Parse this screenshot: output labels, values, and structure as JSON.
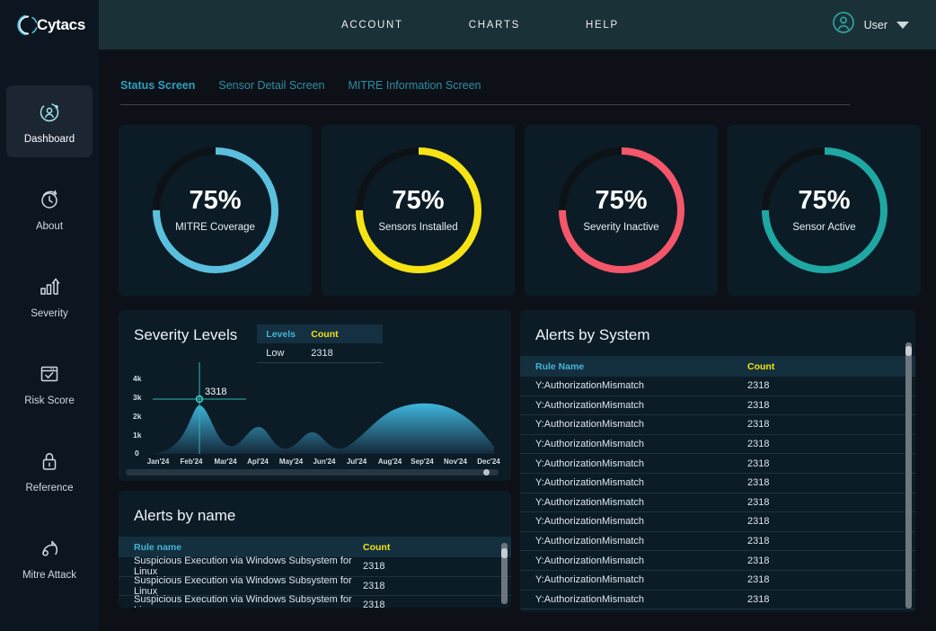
{
  "brand": {
    "name": "Cytacs",
    "logo_icon": "cytacs-arcs-logo"
  },
  "sidebar": {
    "items": [
      {
        "label": "Dashboard",
        "icon": "user-refresh-icon",
        "active": true
      },
      {
        "label": "About",
        "icon": "clock-refresh-icon",
        "active": false
      },
      {
        "label": "Severity",
        "icon": "bar-chart-up-icon",
        "active": false
      },
      {
        "label": "Risk Score",
        "icon": "checklist-window-icon",
        "active": false
      },
      {
        "label": "Reference",
        "icon": "lock-icon",
        "active": false
      },
      {
        "label": "Mitre Attack",
        "icon": "gauge-meter-icon",
        "active": false
      }
    ]
  },
  "header": {
    "nav": [
      {
        "label": "ACCOUNT"
      },
      {
        "label": "CHARTS"
      },
      {
        "label": "HELP"
      }
    ],
    "user": {
      "name": "User",
      "avatar_icon": "user-circle-icon",
      "caret_icon": "caret-down-icon"
    }
  },
  "tabs": [
    {
      "label": "Status Screen",
      "active": true
    },
    {
      "label": "Sensor Detail Screen",
      "active": false
    },
    {
      "label": "MITRE Information Screen",
      "active": false
    }
  ],
  "gauges": [
    {
      "percent": "75%",
      "value": 75,
      "label": "MITRE Coverage",
      "color": "#5bc0de",
      "track": "#0d1216"
    },
    {
      "percent": "75%",
      "value": 75,
      "label": "Sensors Installed",
      "color": "#f5e315",
      "track": "#0d1216"
    },
    {
      "percent": "75%",
      "value": 75,
      "label": "Severity Inactive",
      "color": "#f4566a",
      "track": "#0d1216"
    },
    {
      "percent": "75%",
      "value": 75,
      "label": "Sensor Active",
      "color": "#1fa7a3",
      "track": "#0d1216"
    }
  ],
  "severity_panel": {
    "title": "Severity Levels",
    "legend": {
      "columns": [
        "Levels",
        "Count"
      ],
      "rows": [
        {
          "level": "Low",
          "count": "2318"
        }
      ]
    }
  },
  "chart_data": {
    "type": "area",
    "title": "Severity Levels",
    "xlabel": "",
    "ylabel": "",
    "ylim": [
      0,
      4000
    ],
    "ytick_labels": [
      "0",
      "1k",
      "2k",
      "3k",
      "4k"
    ],
    "ytick_values": [
      0,
      1000,
      2000,
      3000,
      4000
    ],
    "categories": [
      "Jan'24",
      "Feb'24",
      "Mar'24",
      "Apl'24",
      "May'24",
      "Jun'24",
      "Jul'24",
      "Aug'24",
      "Sep'24",
      "Nov'24",
      "Dec'24"
    ],
    "series": [
      {
        "name": "Low",
        "values": [
          60,
          2450,
          700,
          1300,
          620,
          900,
          640,
          1750,
          2380,
          2180,
          380
        ]
      }
    ],
    "annotation": {
      "label": "3318",
      "x_category": "Feb'24",
      "y_value": 3318,
      "crosshair": true
    },
    "grid": false,
    "legend_position": "top-right",
    "has_horizontal_scrollbar": true
  },
  "alerts_by_name": {
    "title": "Alerts by name",
    "columns": [
      "Rule name",
      "Count"
    ],
    "rows": [
      {
        "rule": "Suspicious Execution via Windows Subsystem for Linux",
        "count": "2318"
      },
      {
        "rule": "Suspicious Execution via Windows Subsystem for Linux",
        "count": "2318"
      },
      {
        "rule": "Suspicious Execution via Windows Subsystem for Linux",
        "count": "2318"
      }
    ]
  },
  "alerts_by_system": {
    "title": "Alerts by System",
    "columns": [
      "Rule Name",
      "Count"
    ],
    "rows": [
      {
        "rule": "Y:AuthorizationMismatch",
        "count": "2318"
      },
      {
        "rule": "Y:AuthorizationMismatch",
        "count": "2318"
      },
      {
        "rule": "Y:AuthorizationMismatch",
        "count": "2318"
      },
      {
        "rule": "Y:AuthorizationMismatch",
        "count": "2318"
      },
      {
        "rule": "Y:AuthorizationMismatch",
        "count": "2318"
      },
      {
        "rule": "Y:AuthorizationMismatch",
        "count": "2318"
      },
      {
        "rule": "Y:AuthorizationMismatch",
        "count": "2318"
      },
      {
        "rule": "Y:AuthorizationMismatch",
        "count": "2318"
      },
      {
        "rule": "Y:AuthorizationMismatch",
        "count": "2318"
      },
      {
        "rule": "Y:AuthorizationMismatch",
        "count": "2318"
      },
      {
        "rule": "Y:AuthorizationMismatch",
        "count": "2318"
      },
      {
        "rule": "Y:AuthorizationMismatch",
        "count": "2318"
      }
    ]
  }
}
